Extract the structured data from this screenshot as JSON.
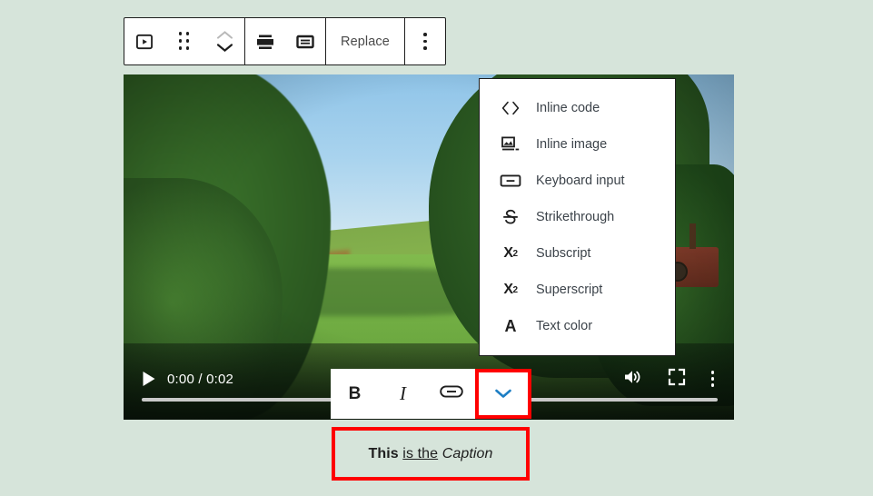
{
  "background_color": "#d6e4da",
  "block_toolbar": {
    "name": "video-block-toolbar",
    "video_block_icon": "video-block-icon",
    "drag_handle_icon": "drag-handle-icon",
    "move_up_icon": "chevron-up-icon",
    "move_down_icon": "chevron-down-icon",
    "align_icon": "align-icon",
    "caption_settings_icon": "caption-settings-icon",
    "replace_label": "Replace",
    "more_options_icon": "more-options-icon"
  },
  "video": {
    "name": "video-player",
    "play_icon": "play-icon",
    "time_display": "0:00 / 0:02",
    "current_time": "0:00",
    "duration": "0:02",
    "volume_icon": "volume-icon",
    "fullscreen_icon": "fullscreen-icon",
    "options_icon": "video-options-icon",
    "progress_percent": 0
  },
  "format_toolbar": {
    "name": "inline-format-toolbar",
    "bold_label": "B",
    "italic_label": "I",
    "link_icon": "link-icon",
    "more_icon": "chevron-down-icon",
    "more_highlight_color": "#ff0000",
    "more_icon_color": "#1d7ec4"
  },
  "dropdown": {
    "name": "more-rich-text-controls-menu",
    "items": [
      {
        "label": "Inline code",
        "icon": "inline-code-icon"
      },
      {
        "label": "Inline image",
        "icon": "inline-image-icon"
      },
      {
        "label": "Keyboard input",
        "icon": "keyboard-input-icon"
      },
      {
        "label": "Strikethrough",
        "icon": "strikethrough-icon"
      },
      {
        "label": "Subscript",
        "icon": "subscript-icon"
      },
      {
        "label": "Superscript",
        "icon": "superscript-icon"
      },
      {
        "label": "Text color",
        "icon": "text-color-icon"
      }
    ]
  },
  "caption": {
    "name": "video-caption",
    "full_text": "This is the Caption",
    "bold_part": "This",
    "link_part": "is the",
    "italic_part": "Caption",
    "highlight_color": "#ff0000"
  }
}
